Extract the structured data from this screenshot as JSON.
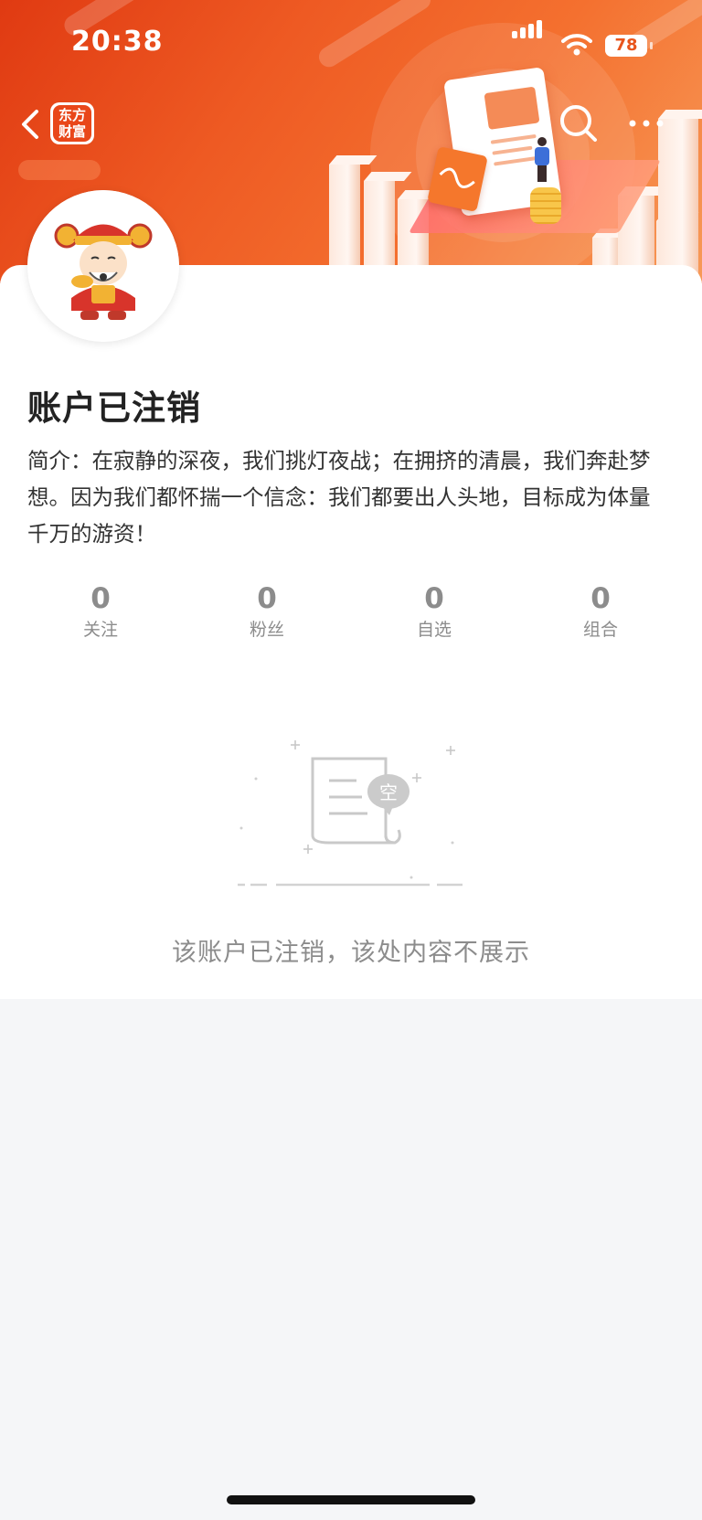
{
  "status_bar": {
    "time": "20:38",
    "battery": "78"
  },
  "nav": {
    "logo_line1": "东方",
    "logo_line2": "财富"
  },
  "profile": {
    "title": "账户已注销",
    "intro": "简介：在寂静的深夜，我们挑灯夜战；在拥挤的清晨，我们奔赴梦想。因为我们都怀揣一个信念：我们都要出人头地，目标成为体量千万的游资！"
  },
  "stats": [
    {
      "value": "0",
      "label": "关注"
    },
    {
      "value": "0",
      "label": "粉丝"
    },
    {
      "value": "0",
      "label": "自选"
    },
    {
      "value": "0",
      "label": "组合"
    }
  ],
  "empty_state": {
    "badge": "空",
    "message": "该账户已注销，该处内容不展示"
  },
  "colors": {
    "brand": "#e9471a",
    "banner_start": "#e03a12",
    "banner_end": "#f79a58",
    "muted_text": "#8c8c8c"
  },
  "icons": [
    "back-icon",
    "search-icon",
    "more-icon",
    "signal-icon",
    "wifi-icon",
    "battery-icon",
    "empty-document-icon"
  ]
}
